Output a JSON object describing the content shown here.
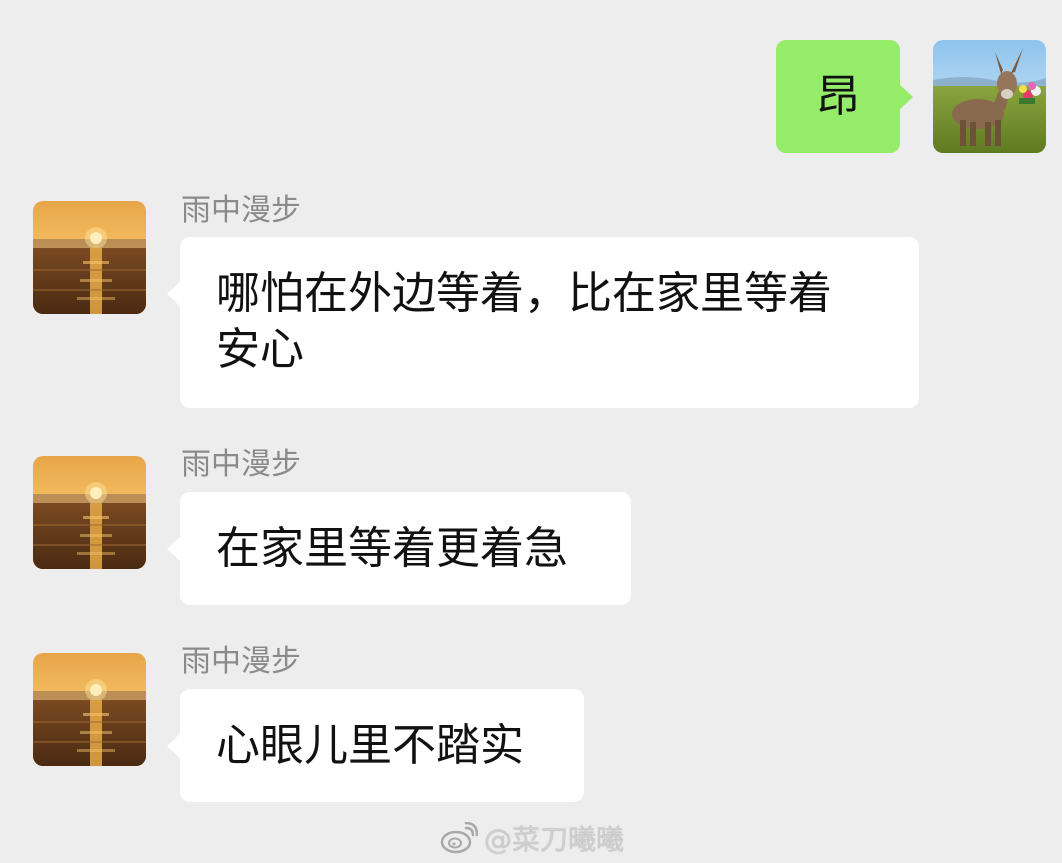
{
  "chat": {
    "outgoing": {
      "text": "昂",
      "avatar_icon": "donkey-photo-avatar"
    },
    "messages": [
      {
        "sender": "雨中漫步",
        "text": "哪怕在外边等着，比在家里等着\n安心",
        "avatar_icon": "sunset-photo-avatar"
      },
      {
        "sender": "雨中漫步",
        "text": "在家里等着更着急",
        "avatar_icon": "sunset-photo-avatar"
      },
      {
        "sender": "雨中漫步",
        "text": "心眼儿里不踏实",
        "avatar_icon": "sunset-photo-avatar"
      }
    ]
  },
  "watermark": {
    "text": "@菜刀曦曦",
    "icon": "weibo-logo-icon"
  },
  "colors": {
    "background": "#ededed",
    "outgoing_bubble": "#95ec69",
    "incoming_bubble": "#ffffff",
    "sender_name": "#8a8a8a"
  }
}
